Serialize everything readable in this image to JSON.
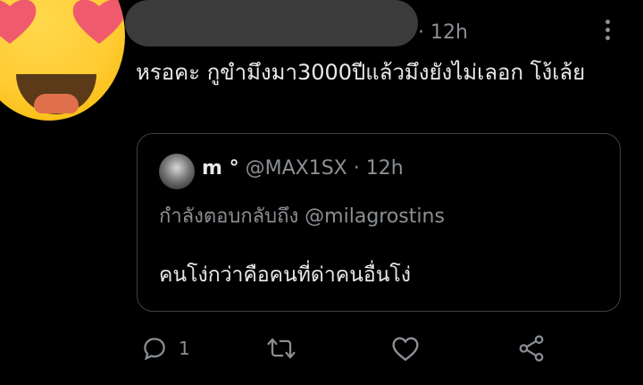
{
  "tweet": {
    "time": "· 12h",
    "text": "หรอคะ กูขำมึงมา3000ปีแล้วมึงยังไม่เลอก โง้เล้ย"
  },
  "quote": {
    "name": "m °",
    "handle": "@MAX1SX · 12h",
    "reply_to": "กำลังตอบกลับถึง @milagrostins",
    "text": "คนโง่กว่าคือคนที่ด่าคนอื่นโง่"
  },
  "actions": {
    "reply_count": "1",
    "icons": [
      "reply-icon",
      "retweet-icon",
      "like-icon",
      "share-icon"
    ]
  },
  "colors": {
    "background": "#000000",
    "text": "#e7e9ea",
    "muted": "#8b8f93",
    "border": "#3d4144"
  }
}
